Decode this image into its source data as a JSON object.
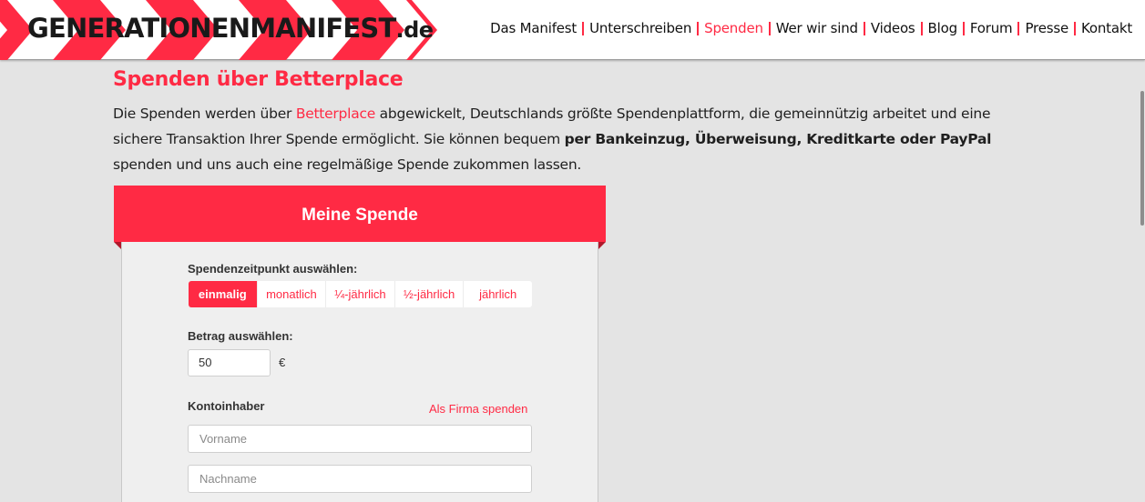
{
  "header": {
    "logo": {
      "main": "GENERATIONENMANIFEST",
      "tld": ".de"
    },
    "nav": [
      {
        "label": "Das Manifest",
        "active": false
      },
      {
        "label": "Unterschreiben",
        "active": false
      },
      {
        "label": "Spenden",
        "active": true
      },
      {
        "label": "Wer wir sind",
        "active": false
      },
      {
        "label": "Videos",
        "active": false
      },
      {
        "label": "Blog",
        "active": false
      },
      {
        "label": "Forum",
        "active": false
      },
      {
        "label": "Presse",
        "active": false
      },
      {
        "label": "Kontakt",
        "active": false
      }
    ]
  },
  "intro": {
    "title": "Spenden über Betterplace",
    "text_before_link": "Die Spenden werden über ",
    "link": "Betterplace",
    "text_after_link": " abgewickelt, Deutschlands größte Spendenplattform, die gemeinnützig arbeitet und eine sichere Transaktion Ihrer Spende ermöglicht. Sie können bequem ",
    "bold_methods": "per Bankeinzug, Überweisung, Kreditkarte oder PayPal",
    "text_end": " spenden und uns auch eine regelmäßige Spende zukommen lassen."
  },
  "widget": {
    "title": "Meine Spende",
    "interval_label": "Spendenzeitpunkt auswählen:",
    "intervals": [
      {
        "label": "einmalig",
        "active": true
      },
      {
        "label": "monatlich",
        "active": false
      },
      {
        "label": "¼-jährlich",
        "active": false
      },
      {
        "label": "½-jährlich",
        "active": false
      },
      {
        "label": "jährlich",
        "active": false
      }
    ],
    "amount_label": "Betrag auswählen:",
    "amount_value": "50",
    "currency": "€",
    "holder_label": "Kontoinhaber",
    "company_link": "Als Firma spenden",
    "firstname_placeholder": "Vorname",
    "lastname_placeholder": "Nachname"
  },
  "colors": {
    "accent": "#ff2a44",
    "accent_dark": "#b0182b",
    "page_bg": "#e4e4e4",
    "form_bg": "#efefef"
  }
}
